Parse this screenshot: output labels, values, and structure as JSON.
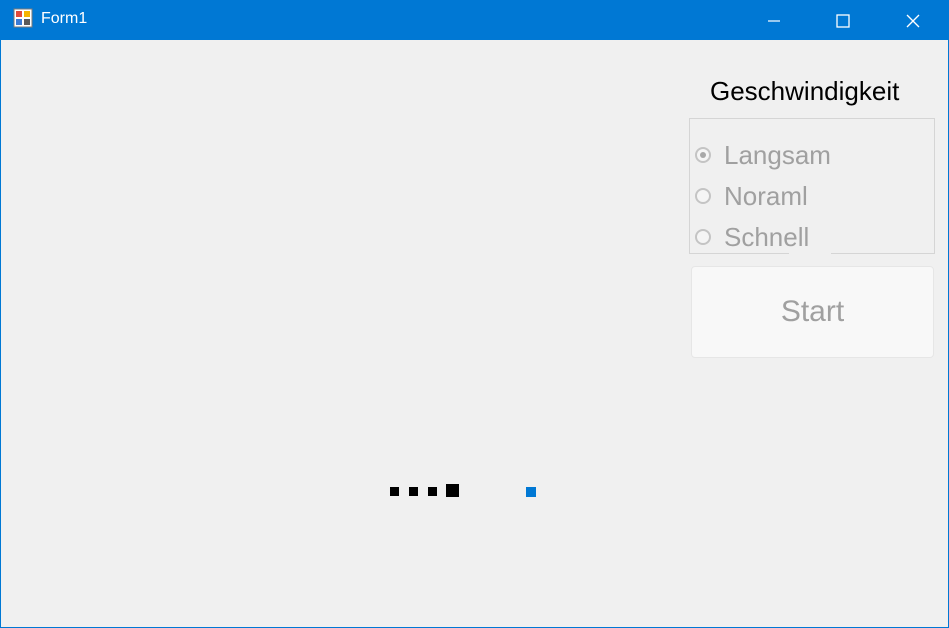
{
  "window": {
    "title": "Form1",
    "accent_color": "#0078d4",
    "controls": {
      "minimize_icon": "minimize-icon",
      "maximize_icon": "maximize-icon",
      "close_icon": "close-icon"
    }
  },
  "speed": {
    "title": "Geschwindigkeit",
    "options": [
      {
        "label": "Langsam",
        "checked": true,
        "enabled": false
      },
      {
        "label": "Noraml",
        "checked": false,
        "enabled": false
      },
      {
        "label": "Schnell",
        "checked": false,
        "enabled": false
      }
    ]
  },
  "start_button": {
    "label": "Start",
    "enabled": false
  },
  "game": {
    "snake_color": "#000000",
    "food_color": "#0078d4"
  }
}
